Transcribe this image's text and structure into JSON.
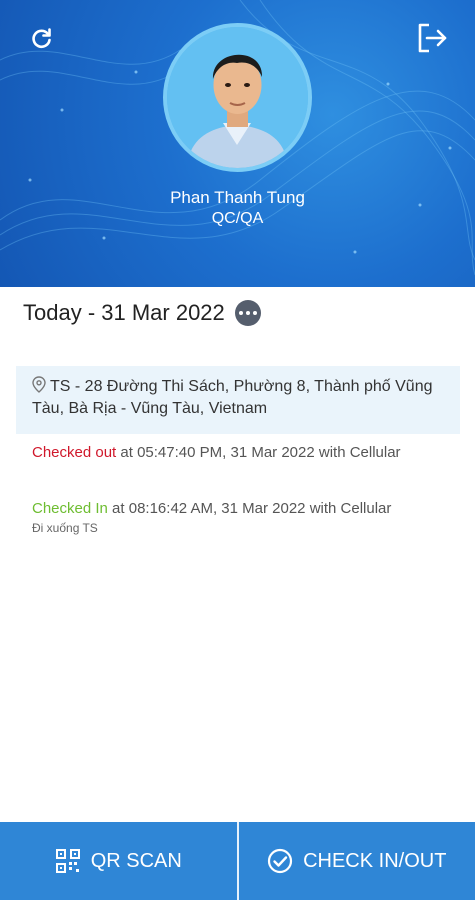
{
  "profile": {
    "name": "Phan Thanh Tung",
    "role": "QC/QA"
  },
  "header_icons": {
    "refresh": "refresh-icon",
    "logout": "logout-icon"
  },
  "date_label": "Today - 31 Mar 2022",
  "location": {
    "icon": "map-pin-icon",
    "text": "TS - 28 Đường Thi Sách, Phường 8, Thành phố Vũng Tàu, Bà Rịa - Vũng Tàu, Vietnam"
  },
  "entries": [
    {
      "status": "Checked out",
      "detail": " at 05:47:40 PM, 31 Mar 2022 with Cellular",
      "status_color": "#d0182b"
    },
    {
      "status": "Checked In",
      "detail": " at 08:16:42 AM, 31 Mar 2022 with Cellular",
      "note": "Đi xuống TS",
      "status_color": "#6ebd31"
    }
  ],
  "actions": {
    "qr_scan": "QR SCAN",
    "check_in_out": "CHECK IN/OUT"
  },
  "colors": {
    "header_blue": "#1d6fce",
    "action_blue": "#2f86d6",
    "location_bg": "#eaf4fb"
  }
}
